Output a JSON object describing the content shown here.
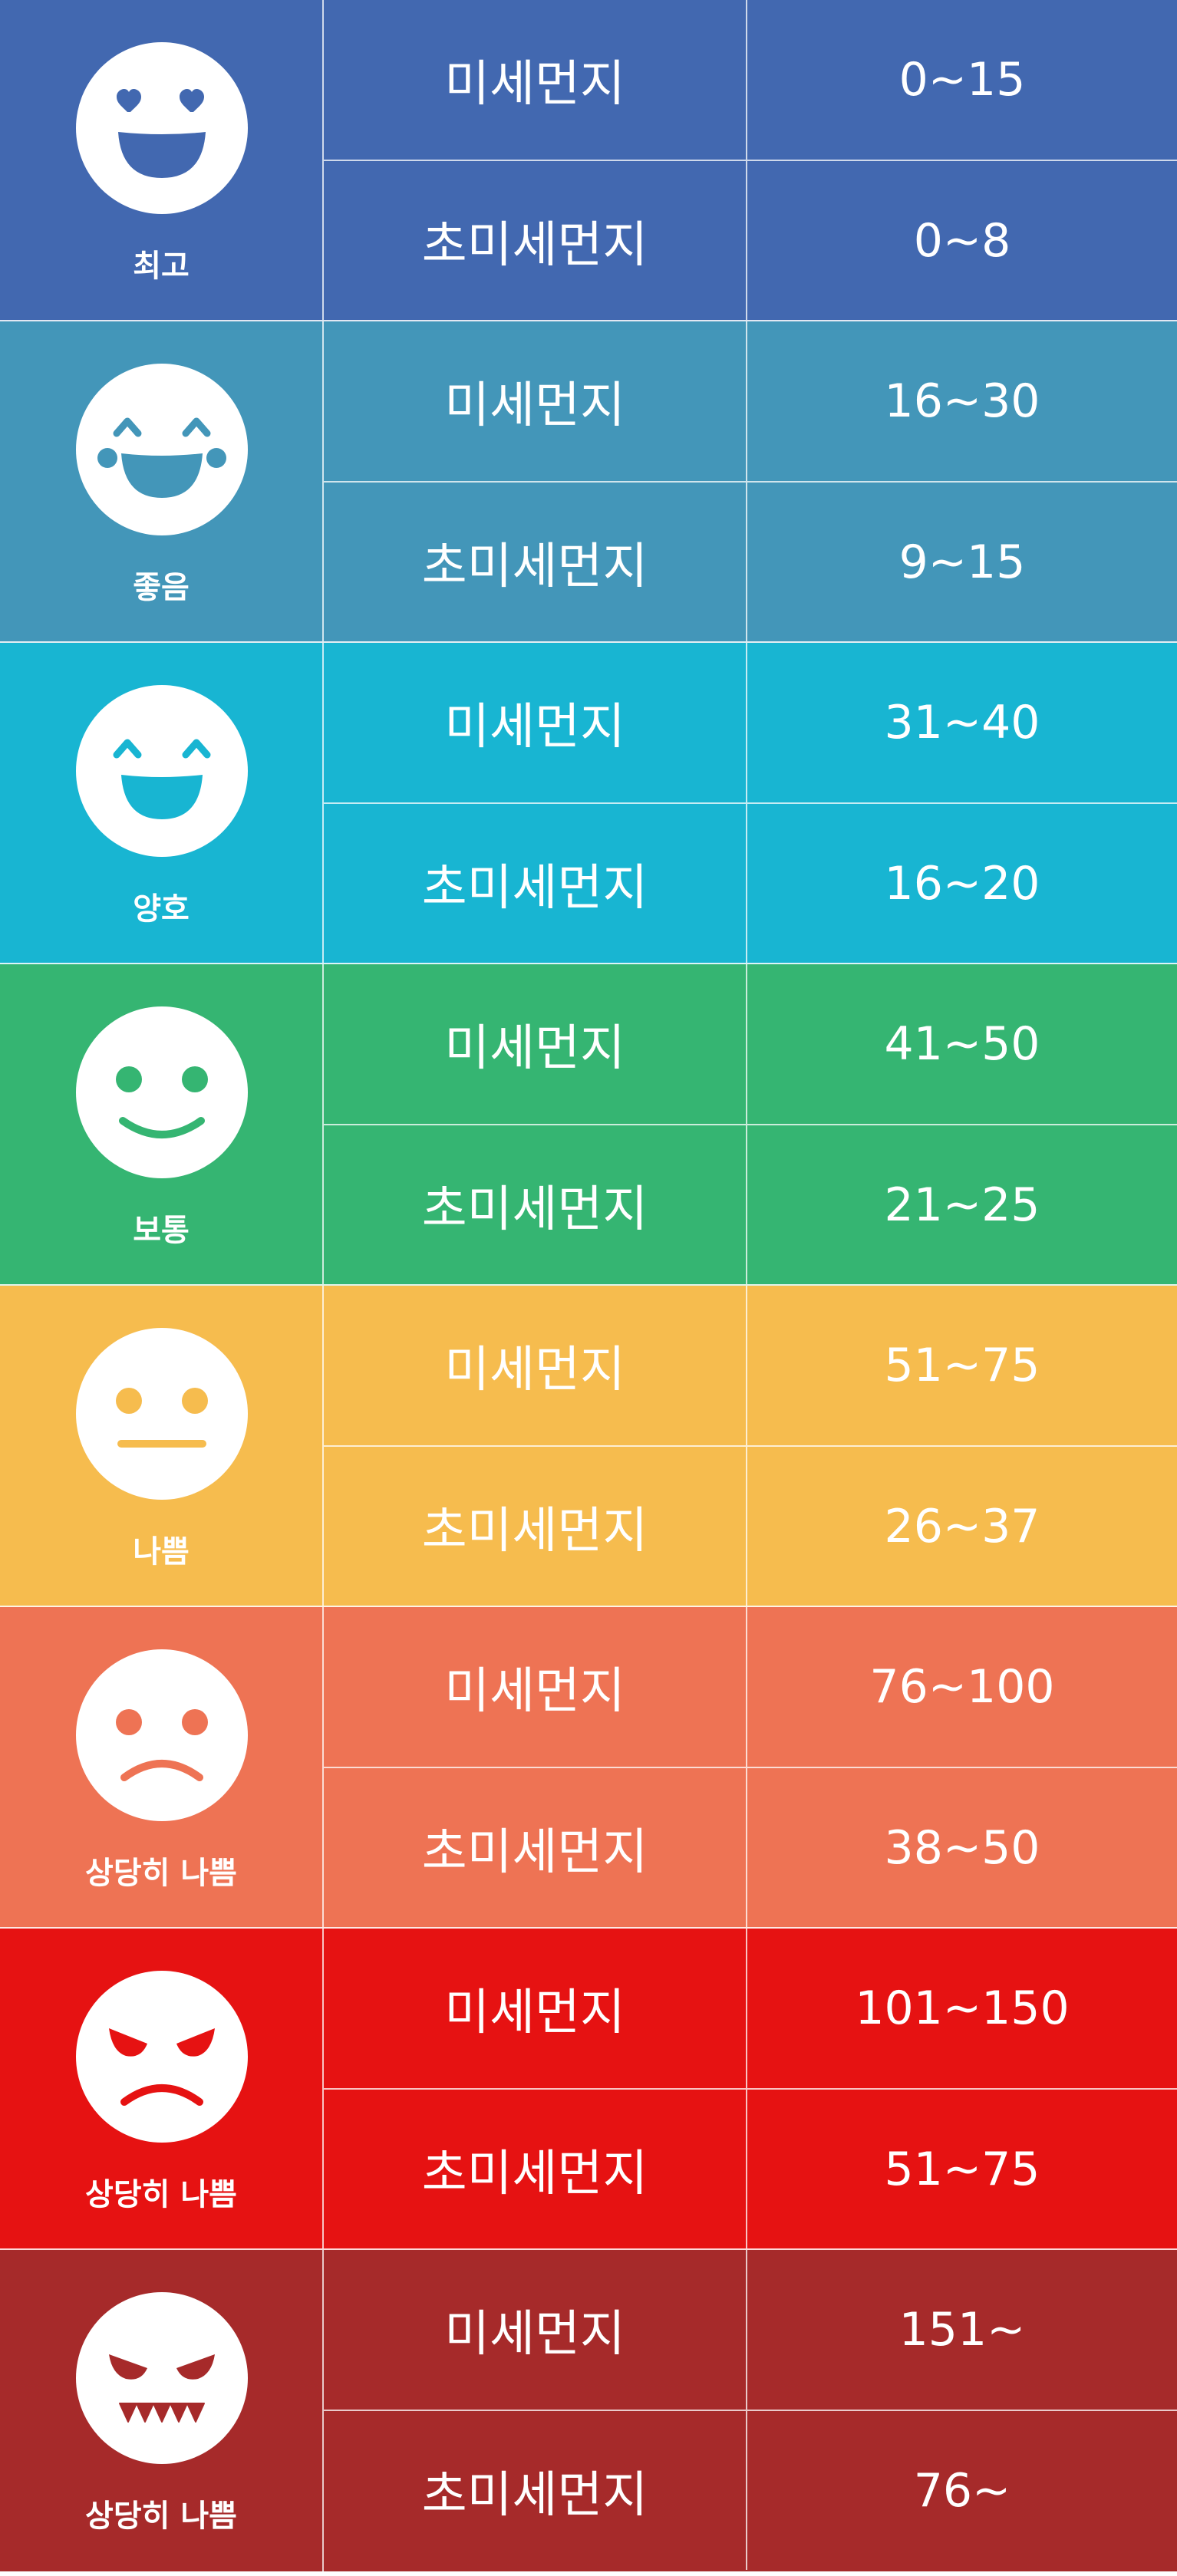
{
  "grades": [
    {
      "label": "최고",
      "color": "#4268B0",
      "face": "heart-eyes-grin-face-icon",
      "rows": [
        {
          "pollutant": "미세먼지",
          "range": "0~15"
        },
        {
          "pollutant": "초미세먼지",
          "range": "0~8"
        }
      ]
    },
    {
      "label": "좋음",
      "color": "#4396B9",
      "face": "laughing-tears-face-icon",
      "rows": [
        {
          "pollutant": "미세먼지",
          "range": "16~30"
        },
        {
          "pollutant": "초미세먼지",
          "range": "9~15"
        }
      ]
    },
    {
      "label": "양호",
      "color": "#18B5D2",
      "face": "happy-grin-face-icon",
      "rows": [
        {
          "pollutant": "미세먼지",
          "range": "31~40"
        },
        {
          "pollutant": "초미세먼지",
          "range": "16~20"
        }
      ]
    },
    {
      "label": "보통",
      "color": "#35B572",
      "face": "smiling-face-icon",
      "rows": [
        {
          "pollutant": "미세먼지",
          "range": "41~50"
        },
        {
          "pollutant": "초미세먼지",
          "range": "21~25"
        }
      ]
    },
    {
      "label": "나쁨",
      "color": "#F6BC4E",
      "face": "neutral-face-icon",
      "rows": [
        {
          "pollutant": "미세먼지",
          "range": "51~75"
        },
        {
          "pollutant": "초미세먼지",
          "range": "26~37"
        }
      ]
    },
    {
      "label": "상당히 나쁨",
      "color": "#EE7354",
      "face": "frowning-face-icon",
      "rows": [
        {
          "pollutant": "미세먼지",
          "range": "76~100"
        },
        {
          "pollutant": "초미세먼지",
          "range": "38~50"
        }
      ]
    },
    {
      "label": "상당히 나쁨",
      "color": "#E61212",
      "face": "angry-face-icon",
      "rows": [
        {
          "pollutant": "미세먼지",
          "range": "101~150"
        },
        {
          "pollutant": "초미세먼지",
          "range": "51~75"
        }
      ]
    },
    {
      "label": "상당히 나쁨",
      "color": "#A62A2A",
      "face": "fanged-angry-face-icon",
      "rows": [
        {
          "pollutant": "미세먼지",
          "range": "151~"
        },
        {
          "pollutant": "초미세먼지",
          "range": "76~"
        }
      ]
    }
  ]
}
